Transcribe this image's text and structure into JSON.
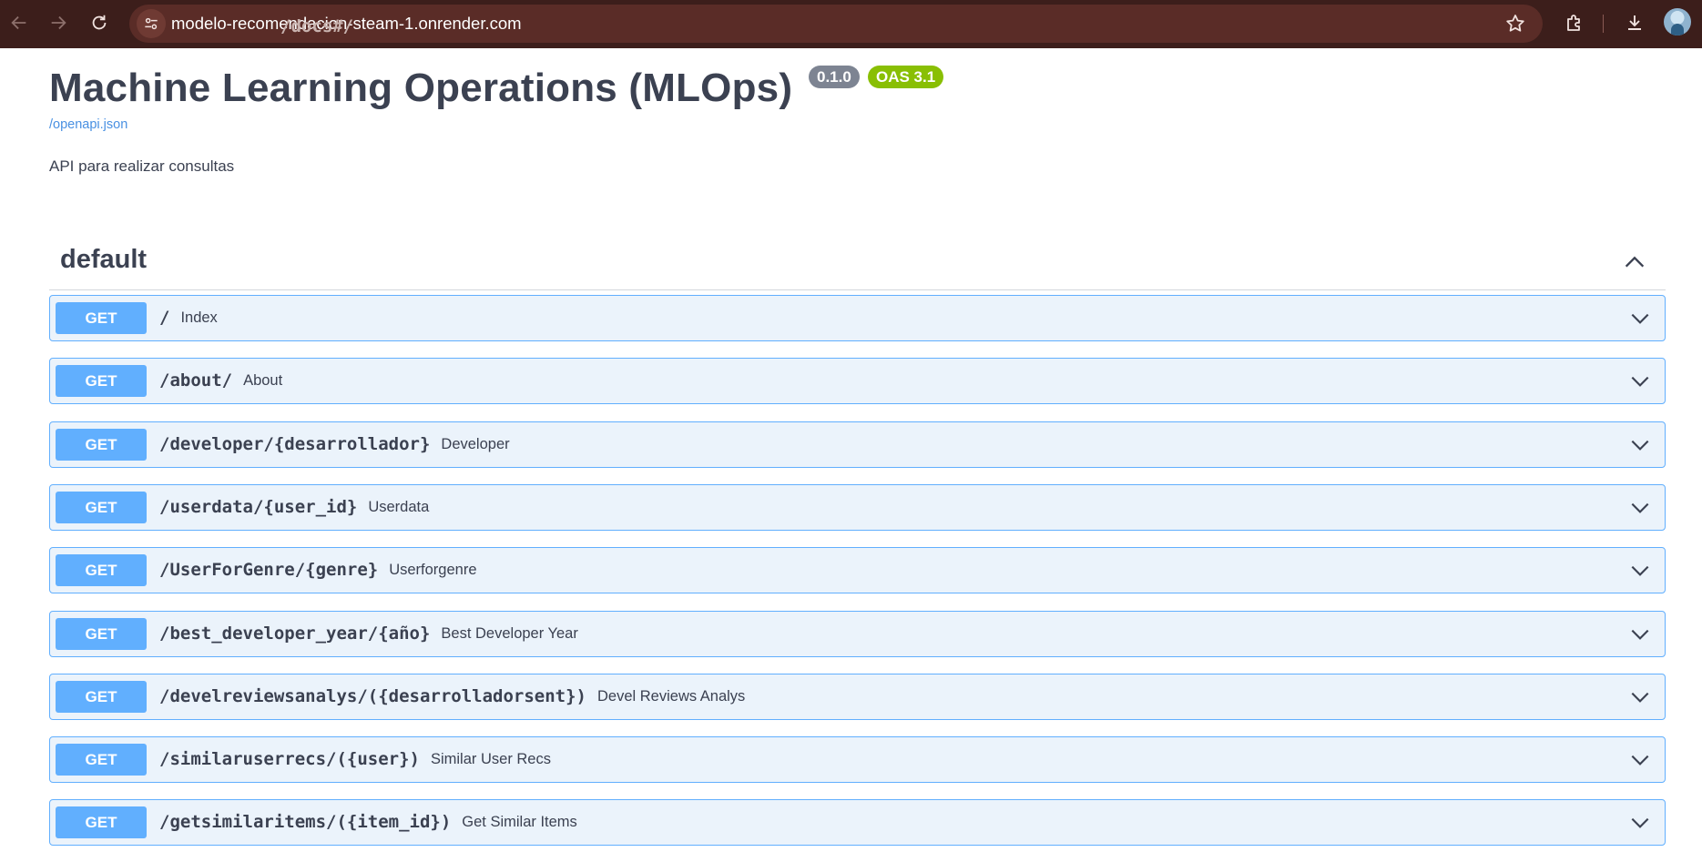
{
  "browser": {
    "url_host": "modelo-recomendacion-steam-1.onrender.com",
    "url_path": "/docs#/",
    "icons": [
      "back-icon",
      "forward-icon",
      "reload-icon",
      "site-info-icon",
      "bookmark-star-icon",
      "extensions-icon",
      "downloads-icon",
      "profile-avatar"
    ]
  },
  "info": {
    "title": "Machine Learning Operations (MLOps)",
    "version": "0.1.0",
    "oas": "OAS 3.1",
    "spec_link": "/openapi.json",
    "description": "API para realizar consultas"
  },
  "tag": {
    "name": "default",
    "expanded": true
  },
  "operations": [
    {
      "method": "GET",
      "path": "/",
      "summary": "Index"
    },
    {
      "method": "GET",
      "path": "/about/",
      "summary": "About"
    },
    {
      "method": "GET",
      "path": "/developer/{desarrollador}",
      "summary": "Developer"
    },
    {
      "method": "GET",
      "path": "/userdata/{user_id}",
      "summary": "Userdata"
    },
    {
      "method": "GET",
      "path": "/UserForGenre/{genre}",
      "summary": "Userforgenre"
    },
    {
      "method": "GET",
      "path": "/best_developer_year/{año}",
      "summary": "Best Developer Year"
    },
    {
      "method": "GET",
      "path": "/develreviewsanalys/({desarrolladorsent})",
      "summary": "Devel Reviews Analys"
    },
    {
      "method": "GET",
      "path": "/similaruserrecs/({user})",
      "summary": "Similar User Recs"
    },
    {
      "method": "GET",
      "path": "/getsimilaritems/({item_id})",
      "summary": "Get Similar Items"
    }
  ],
  "colors": {
    "get_accent": "#61affe",
    "get_background": "#ebf3fb",
    "version_badge": "#7d8492",
    "oas_badge": "#89bf04",
    "chrome": "#3c1e1b"
  }
}
